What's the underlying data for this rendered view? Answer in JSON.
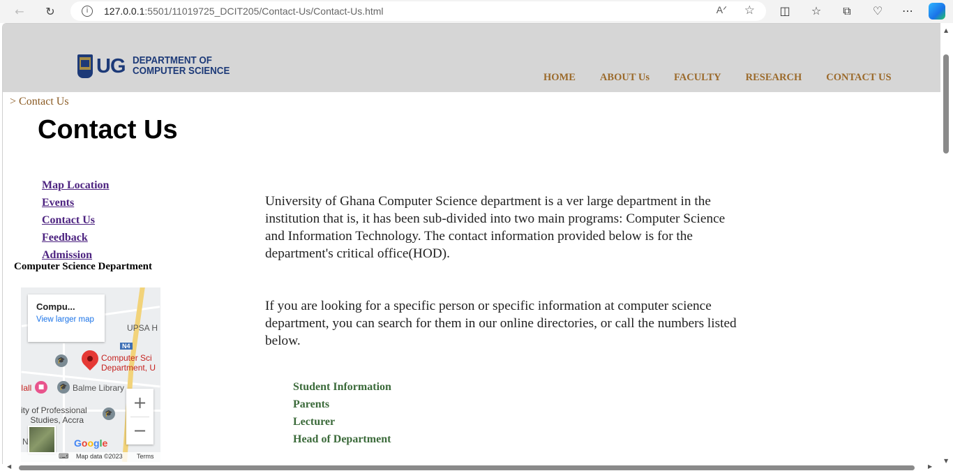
{
  "browser": {
    "url_host": "127.0.0.1",
    "url_rest": ":5501/11019725_DCIT205/Contact-Us/Contact-Us.html"
  },
  "header": {
    "logo_short": "UG",
    "logo_line1": "DEPARTMENT OF",
    "logo_line2": "COMPUTER SCIENCE",
    "nav": [
      "HOME",
      "ABOUT Us",
      "FACULTY",
      "RESEARCH",
      "CONTACT US"
    ]
  },
  "breadcrumb": "> Contact Us",
  "page_title": "Contact Us",
  "sidebar": {
    "links": [
      "Map Location",
      "Events",
      "Contact Us",
      "Feedback",
      "Admission"
    ],
    "dept_label": "Computer Science Department"
  },
  "map": {
    "card_title": "Compu...",
    "card_link": "View larger map",
    "labels": {
      "upsa": "UPSA H",
      "n4": "N4",
      "pin": "Computer Sci\nDepartment, U",
      "balme": "Balme Library",
      "hall": "Iall",
      "professional": "ity of Professional\n    Studies, Accra",
      "n": "N"
    },
    "google": "Google",
    "footer_data": "Map data ©2023",
    "footer_terms": "Terms"
  },
  "content": {
    "para1": "University of Ghana Computer Science department is a ver large department in the institution that is, it has been sub-divided into two main programs: Computer Science and Information Technology. The contact information provided below is for the department's critical office(HOD).",
    "para2": "If you are looking for a specific person or specific information at computer science department, you can search for them in our online directories, or call the numbers listed below.",
    "contacts": [
      "Student Information",
      "Parents",
      "Lecturer",
      "Head of Department"
    ]
  },
  "colors": {
    "nav_text": "#9b6a2b",
    "sidebar_link": "#4d2380",
    "contact_text": "#3b6a3a",
    "header_bg": "#d6d6d6"
  }
}
